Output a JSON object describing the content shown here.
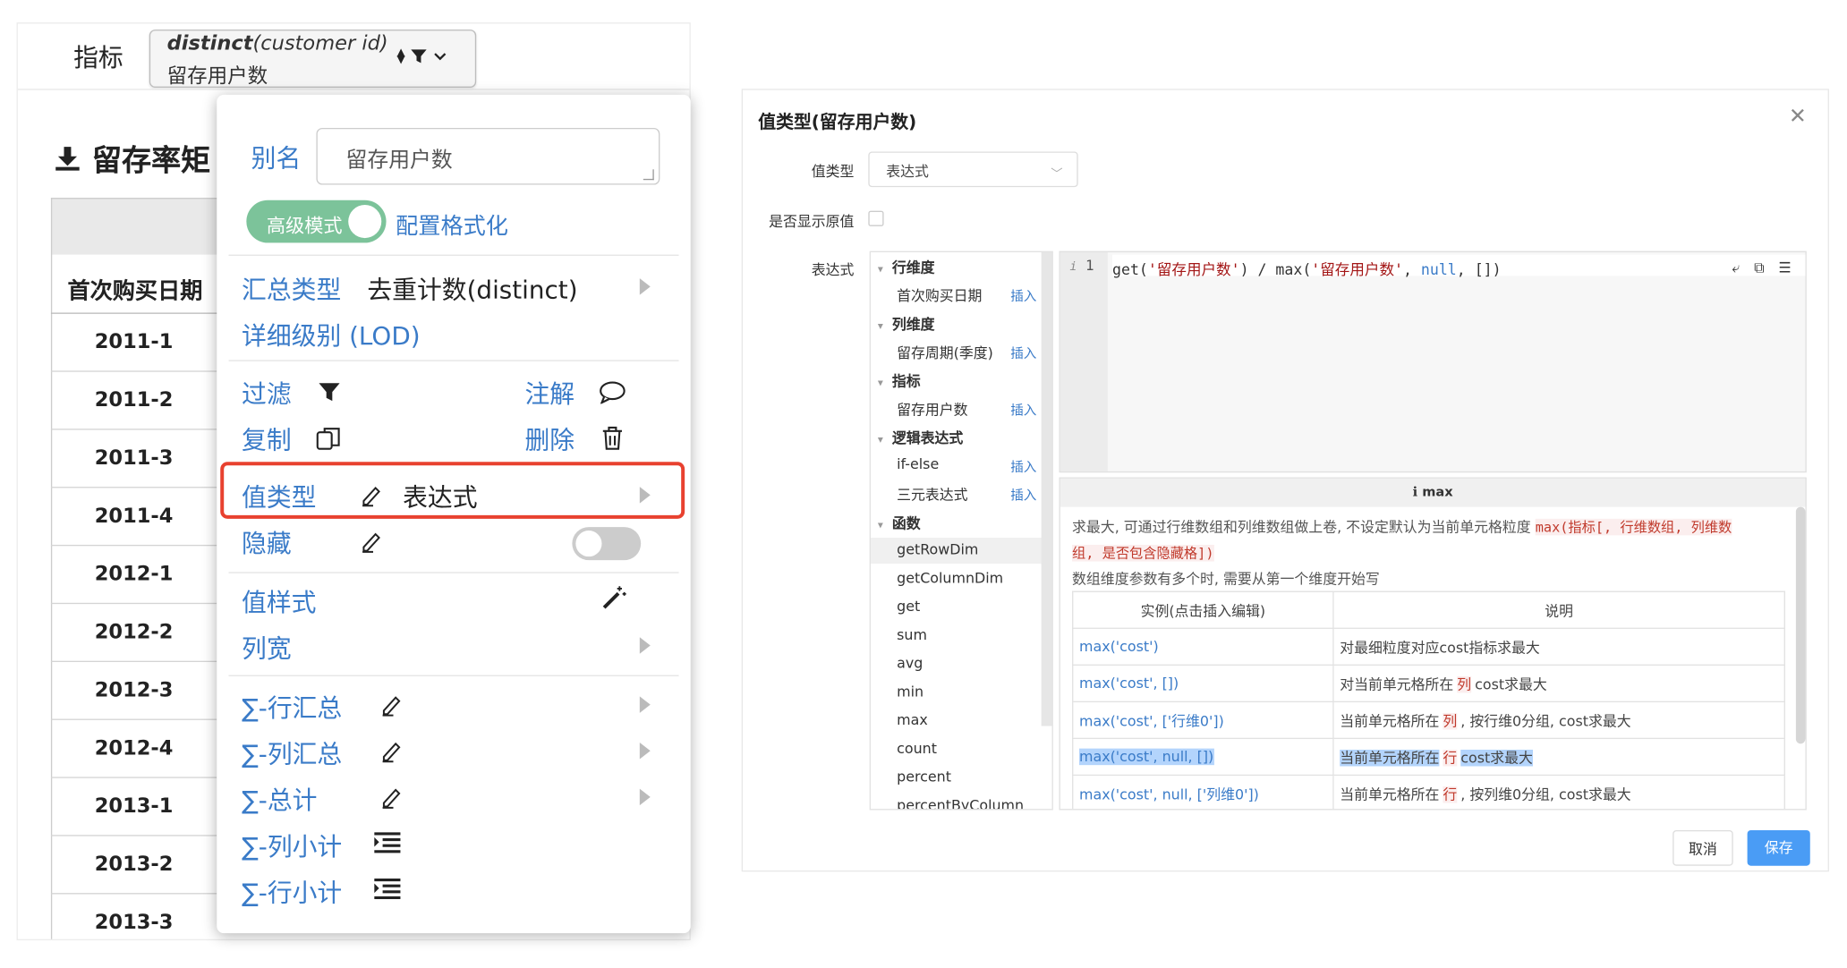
{
  "left": {
    "indicator_label": "指标",
    "pill": {
      "func": "distinct",
      "arg": "(customer id)",
      "name": "留存用户数"
    },
    "report_title": "留存率矩",
    "column_header": "首次购买日期",
    "rows": [
      "2011-1",
      "2011-2",
      "2011-3",
      "2011-4",
      "2012-1",
      "2012-2",
      "2012-3",
      "2012-4",
      "2013-1",
      "2013-2",
      "2013-3"
    ]
  },
  "menu": {
    "alias_label": "别名",
    "alias_value": "留存用户数",
    "advanced_mode": "高级模式",
    "config_format": "配置格式化",
    "agg_type_label": "汇总类型",
    "agg_type_value": "去重计数(distinct)",
    "lod": "详细级别 (LOD)",
    "filter": "过滤",
    "annotate": "注解",
    "copy": "复制",
    "delete": "删除",
    "value_type_label": "值类型",
    "value_type_value": "表达式",
    "hide": "隐藏",
    "value_style": "值样式",
    "col_width": "列宽",
    "row_total": "∑-行汇总",
    "col_total": "∑-列汇总",
    "grand_total": "∑-总计",
    "col_subtotal": "∑-列小计",
    "row_subtotal": "∑-行小计"
  },
  "dialog": {
    "title": "值类型(留存用户数)",
    "value_type_label": "值类型",
    "value_type_selected": "表达式",
    "show_raw_label": "是否显示原值",
    "expr_label": "表达式",
    "insert": "插入",
    "tree": [
      {
        "group": "行维度",
        "items": [
          "首次购买日期"
        ]
      },
      {
        "group": "列维度",
        "items": [
          "留存周期(季度)"
        ]
      },
      {
        "group": "指标",
        "items": [
          "留存用户数"
        ]
      },
      {
        "group": "逻辑表达式",
        "items": [
          "if-else",
          "三元表达式"
        ]
      },
      {
        "group": "函数",
        "items": [
          "getRowDim",
          "getColumnDim",
          "get",
          "sum",
          "avg",
          "min",
          "max",
          "count",
          "percent",
          "percentByColumn"
        ]
      }
    ],
    "code_line_no": "1",
    "code": {
      "p1": "get(",
      "s1": "'留存用户数'",
      "p2": ") / max(",
      "s2": "'留存用户数'",
      "p3": ", ",
      "k1": "null",
      "p4": ", [])"
    },
    "doc_title": "max",
    "doc_desc": "求最大, 可通过行维数组和列维数组做上卷, 不设定默认为当前单元格粒度",
    "doc_sig": "max(指标[, 行维数组, 列维数组, 是否包含隐藏格])",
    "doc_sig_a": "max(指标[, 行维数组, 列维数",
    "doc_sig_b": "组, 是否包含隐藏格])",
    "doc_note": "数组维度参数有多个时, 需要从第一个维度开始写",
    "th_example": "实例(点击插入编辑)",
    "th_desc": "说明",
    "examples": [
      {
        "ex": "max('cost')",
        "d1": "对最细粒度对应cost指标求最大",
        "tag": "",
        "d2": ""
      },
      {
        "ex": "max('cost', [])",
        "d1": "对当前单元格所在",
        "tag": "列",
        "d2": "cost求最大"
      },
      {
        "ex": "max('cost', ['行维0'])",
        "d1": "当前单元格所在",
        "tag": "列",
        "d2": ", 按行维0分组, cost求最大"
      },
      {
        "ex": "max('cost', null, [])",
        "d1": "当前单元格所在",
        "tag": "行",
        "d2": "cost求最大"
      },
      {
        "ex": "max('cost', null, ['列维0'])",
        "d1": "当前单元格所在",
        "tag": "行",
        "d2": ", 按列维0分组, cost求最大"
      }
    ],
    "cancel": "取消",
    "save": "保存"
  }
}
